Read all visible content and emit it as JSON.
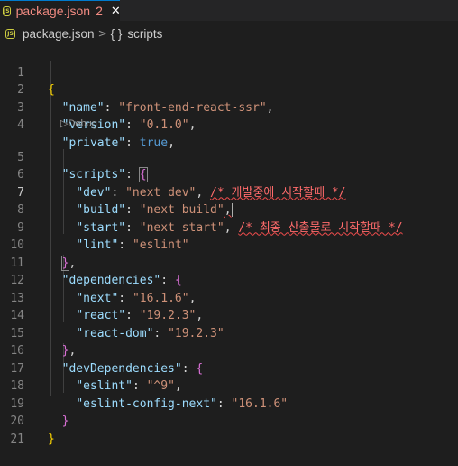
{
  "tab": {
    "filename": "package.json",
    "badge": "2",
    "close": "✕",
    "icon": "JS"
  },
  "breadcrumb": {
    "file": "package.json",
    "sep": ">",
    "symbol_icon": "{ }",
    "symbol": "scripts"
  },
  "codelens": {
    "label": "Debug",
    "icon": "play-outline-icon"
  },
  "lines": [
    {
      "n": "1"
    },
    {
      "n": "2"
    },
    {
      "n": "3"
    },
    {
      "n": "4"
    },
    {
      "n": "5"
    },
    {
      "n": "6"
    },
    {
      "n": "7"
    },
    {
      "n": "8"
    },
    {
      "n": "9"
    },
    {
      "n": "10"
    },
    {
      "n": "11"
    },
    {
      "n": "12"
    },
    {
      "n": "13"
    },
    {
      "n": "14"
    },
    {
      "n": "15"
    },
    {
      "n": "16"
    },
    {
      "n": "17"
    },
    {
      "n": "18"
    },
    {
      "n": "19"
    },
    {
      "n": "20"
    },
    {
      "n": "21"
    }
  ],
  "code": {
    "l1_open": "{",
    "name_key": "\"name\"",
    "name_val": "\"front-end-react-ssr\"",
    "version_key": "\"version\"",
    "version_val": "\"0.1.0\"",
    "private_key": "\"private\"",
    "private_val": "true",
    "scripts_key": "\"scripts\"",
    "scripts_open": "{",
    "dev_key": "\"dev\"",
    "dev_val": "\"next dev\"",
    "dev_comment": "/* 개발중에 시작할때 */",
    "build_key": "\"build\"",
    "build_val": "\"next build\"",
    "start_key": "\"start\"",
    "start_val": "\"next start\"",
    "start_comment": "/* 최종 산출물로 시작할때 */",
    "lint_key": "\"lint\"",
    "lint_val": "\"eslint\"",
    "scripts_close": "}",
    "deps_key": "\"dependencies\"",
    "deps_open": "{",
    "next_key": "\"next\"",
    "next_val": "\"16.1.6\"",
    "react_key": "\"react\"",
    "react_val": "\"19.2.3\"",
    "reactdom_key": "\"react-dom\"",
    "reactdom_val": "\"19.2.3\"",
    "deps_close": "}",
    "devdeps_key": "\"devDependencies\"",
    "devdeps_open": "{",
    "eslint_key": "\"eslint\"",
    "eslint_val": "\"^9\"",
    "eslintcfg_key": "\"eslint-config-next\"",
    "eslintcfg_val": "\"16.1.6\"",
    "devdeps_close": "}",
    "l20_close": "}"
  },
  "colors": {
    "key": "#9cdcfe",
    "string": "#ce9178",
    "bracket1": "#ffd700",
    "bracket2": "#da70d6",
    "keyword": "#569cd6",
    "error": "#f14c4c"
  }
}
